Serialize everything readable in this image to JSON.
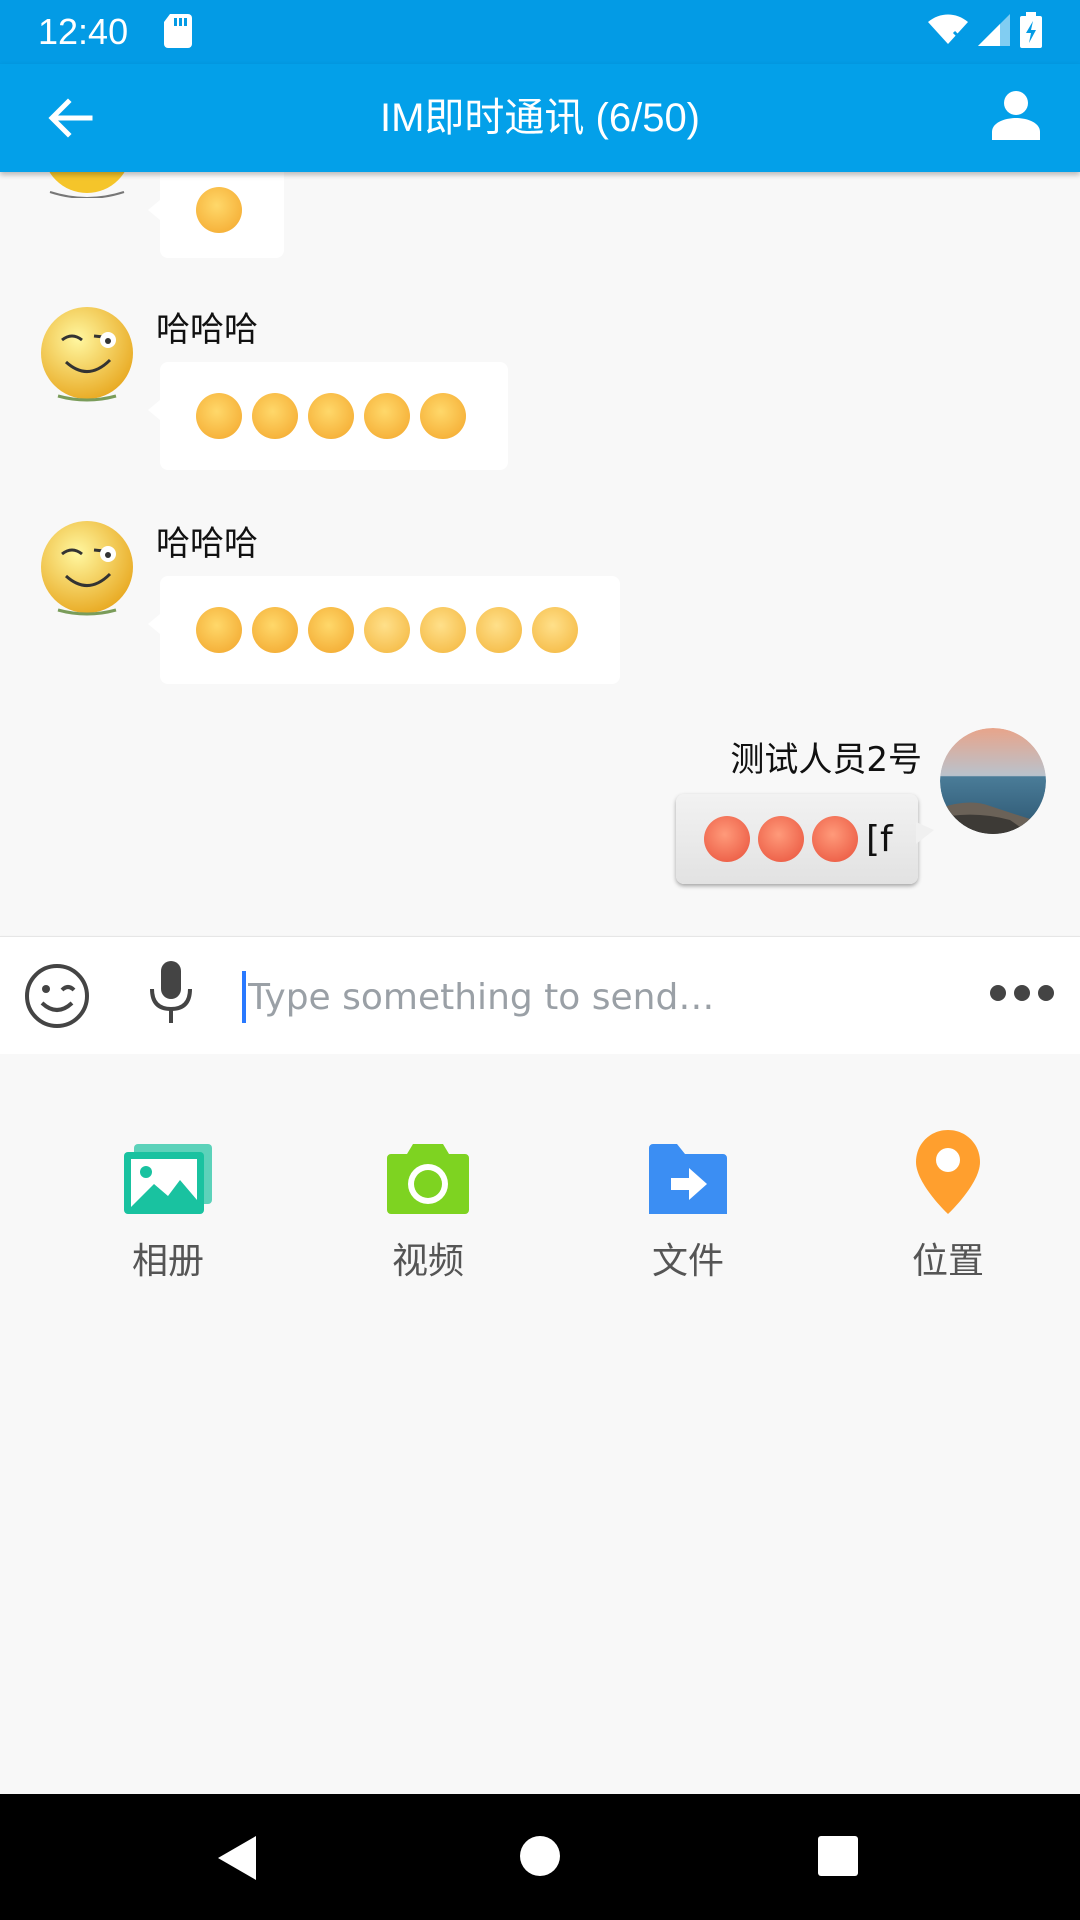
{
  "status_bar": {
    "time": "12:40",
    "icons": [
      "sd-card-icon",
      "wifi-icon",
      "signal-icon",
      "battery-icon"
    ]
  },
  "app_bar": {
    "title": "IM即时通讯 (6/50)",
    "back_icon": "arrow-back-icon",
    "profile_icon": "person-icon",
    "color": "#03a0e9"
  },
  "messages": [
    {
      "direction": "in",
      "sender": "",
      "emojis": [
        "wink-emoji"
      ],
      "partially_visible": true
    },
    {
      "direction": "in",
      "sender": "哈哈哈",
      "emojis": [
        "wink-emoji",
        "wink-emoji",
        "wink-emoji",
        "wink-emoji",
        "wink-emoji"
      ]
    },
    {
      "direction": "in",
      "sender": "哈哈哈",
      "emojis": [
        "grin-emoji",
        "grin-emoji",
        "grin-emoji",
        "teary-emoji",
        "teary-emoji",
        "teary-emoji",
        "teary-emoji"
      ]
    },
    {
      "direction": "out",
      "sender": "测试人员2号",
      "emojis": [
        "sweat-emoji",
        "sweat-emoji",
        "sweat-emoji"
      ],
      "trailing_text": "[f"
    }
  ],
  "input": {
    "placeholder": "Type something to send…",
    "value": "",
    "emoji_button_icon": "emoji-icon",
    "mic_button_icon": "microphone-icon",
    "more_button_icon": "more-horizontal-icon"
  },
  "panel": {
    "items": [
      {
        "label": "相册",
        "icon": "album-icon",
        "color": "#19c2a0"
      },
      {
        "label": "视频",
        "icon": "camera-icon",
        "color": "#7ed321"
      },
      {
        "label": "文件",
        "icon": "file-icon",
        "color": "#3b8ef3"
      },
      {
        "label": "位置",
        "icon": "location-icon",
        "color": "#ff9f2e"
      }
    ]
  },
  "nav_bar": {
    "icons": [
      "back-triangle-icon",
      "home-circle-icon",
      "recents-square-icon"
    ]
  }
}
